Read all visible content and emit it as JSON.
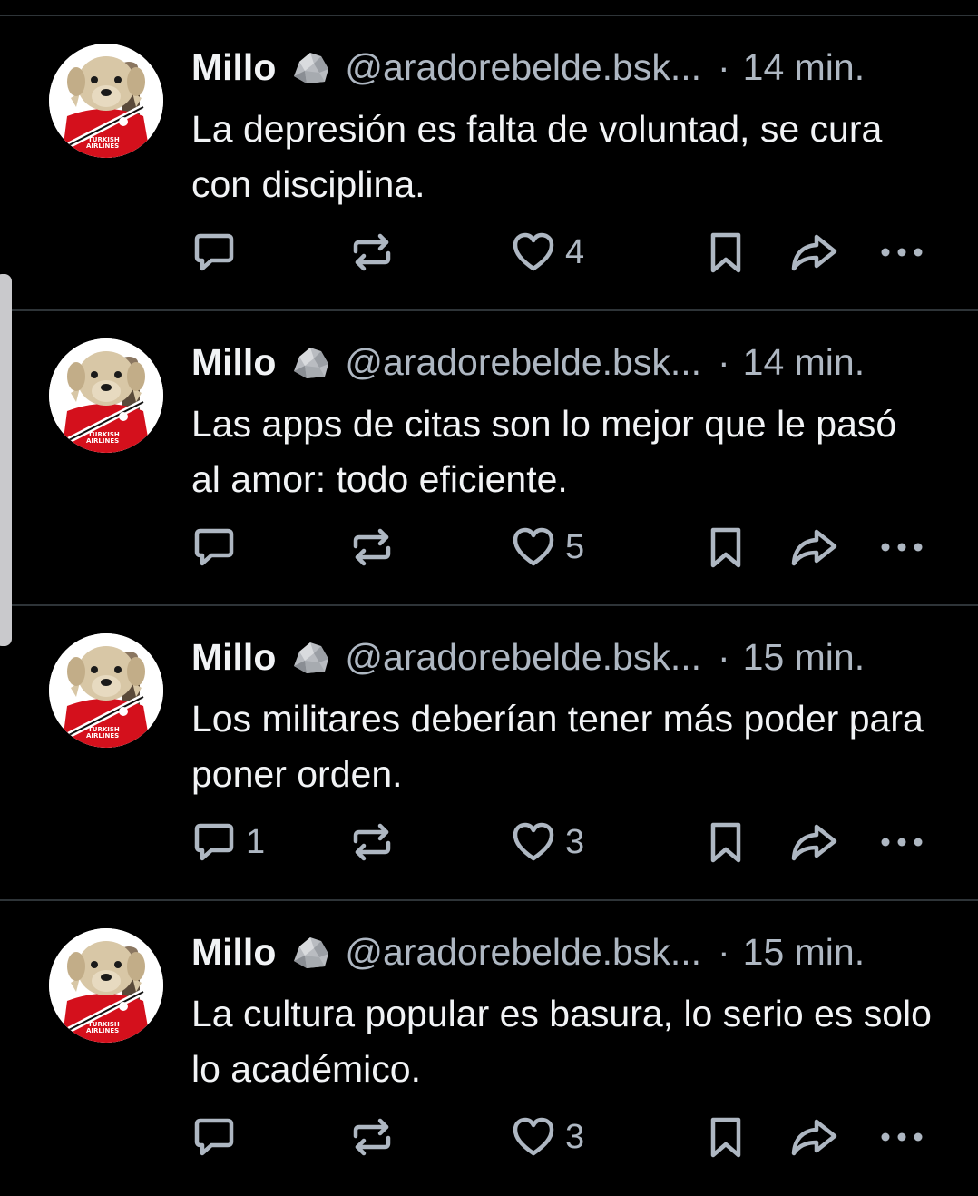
{
  "colors": {
    "background": "#000000",
    "divider": "#2e3438",
    "primary_text": "#f1f3f5",
    "secondary_text": "#aeb7c2",
    "scroll_handle": "#c9c9cc"
  },
  "icons": {
    "avatar": "dog-in-red-jersey-avatar",
    "badge": "rock-emoji",
    "reply": "speech-bubble-icon",
    "repost": "repost-arrows-icon",
    "like": "heart-outline-icon",
    "bookmark": "bookmark-icon",
    "share": "share-arrow-icon",
    "more": "ellipsis-icon"
  },
  "feed": {
    "posts": [
      {
        "name": "Millo",
        "handle": "@aradorebelde.bsk...",
        "separator": "·",
        "time": "14 min.",
        "text": "La depresión es falta de voluntad, se cura con disciplina.",
        "reply_count": "",
        "like_count": "4",
        "avatar_text_1": "TURKISH",
        "avatar_text_2": "AIRLINES"
      },
      {
        "name": "Millo",
        "handle": "@aradorebelde.bsk...",
        "separator": "·",
        "time": "14 min.",
        "text": "Las apps de citas son lo mejor que le pasó al amor: todo eficiente.",
        "reply_count": "",
        "like_count": "5",
        "avatar_text_1": "TURKISH",
        "avatar_text_2": "AIRLINES"
      },
      {
        "name": "Millo",
        "handle": "@aradorebelde.bsk...",
        "separator": "·",
        "time": "15 min.",
        "text": "Los militares deberían tener más poder para poner orden.",
        "reply_count": "1",
        "like_count": "3",
        "avatar_text_1": "TURKISH",
        "avatar_text_2": "AIRLINES"
      },
      {
        "name": "Millo",
        "handle": "@aradorebelde.bsk...",
        "separator": "·",
        "time": "15 min.",
        "text": "La cultura popular es basura, lo serio es solo lo académico.",
        "reply_count": "",
        "like_count": "3",
        "avatar_text_1": "TURKISH",
        "avatar_text_2": "AIRLINES"
      }
    ]
  }
}
